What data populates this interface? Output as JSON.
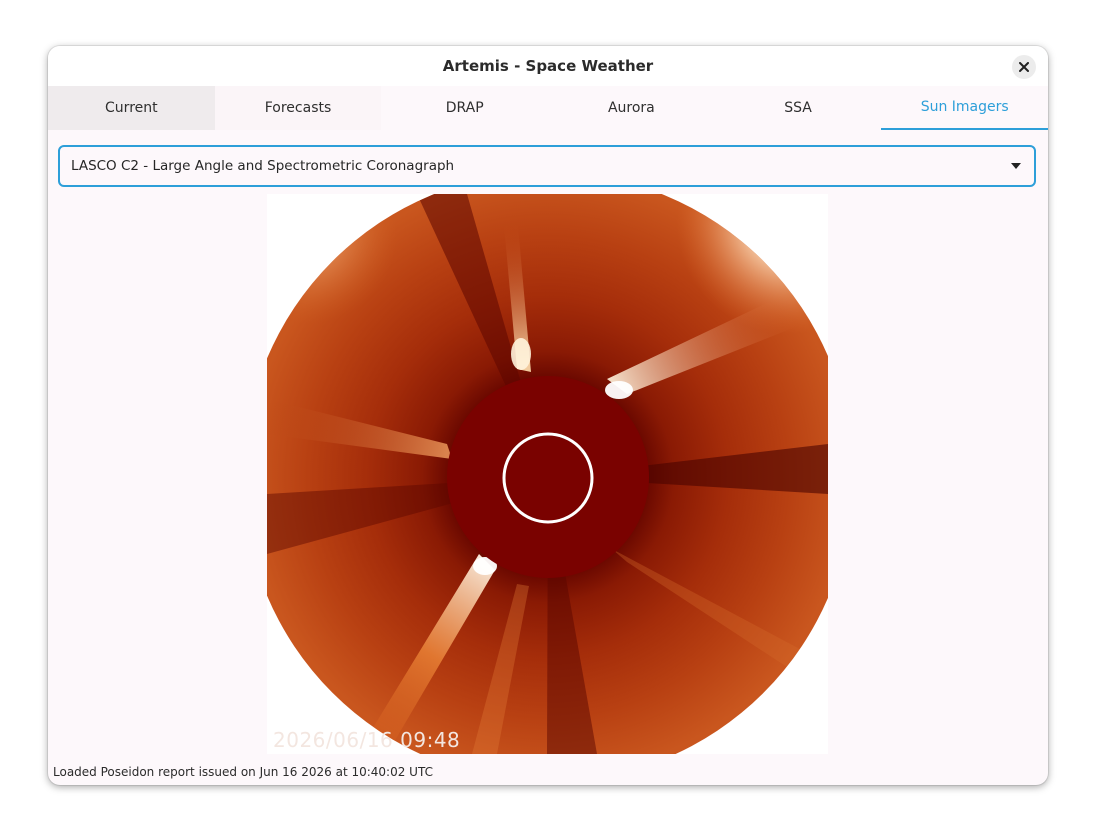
{
  "window": {
    "title": "Artemis - Space Weather",
    "close_icon": "close-icon"
  },
  "tabs": [
    {
      "label": "Current"
    },
    {
      "label": "Forecasts"
    },
    {
      "label": "DRAP"
    },
    {
      "label": "Aurora"
    },
    {
      "label": "SSA"
    },
    {
      "label": "Sun Imagers",
      "active": true
    }
  ],
  "imager_select": {
    "value": "LASCO C2 - Large Angle and Spectrometric Coronagraph",
    "caret_icon": "caret-down-icon"
  },
  "image": {
    "timestamp": "2026/06/16 09:48"
  },
  "status": {
    "text": "Loaded Poseidon report issued on Jun 16 2026 at 10:40:02 UTC"
  },
  "colors": {
    "accent": "#2d9fd9",
    "window_bg": "#fdf8fb"
  }
}
